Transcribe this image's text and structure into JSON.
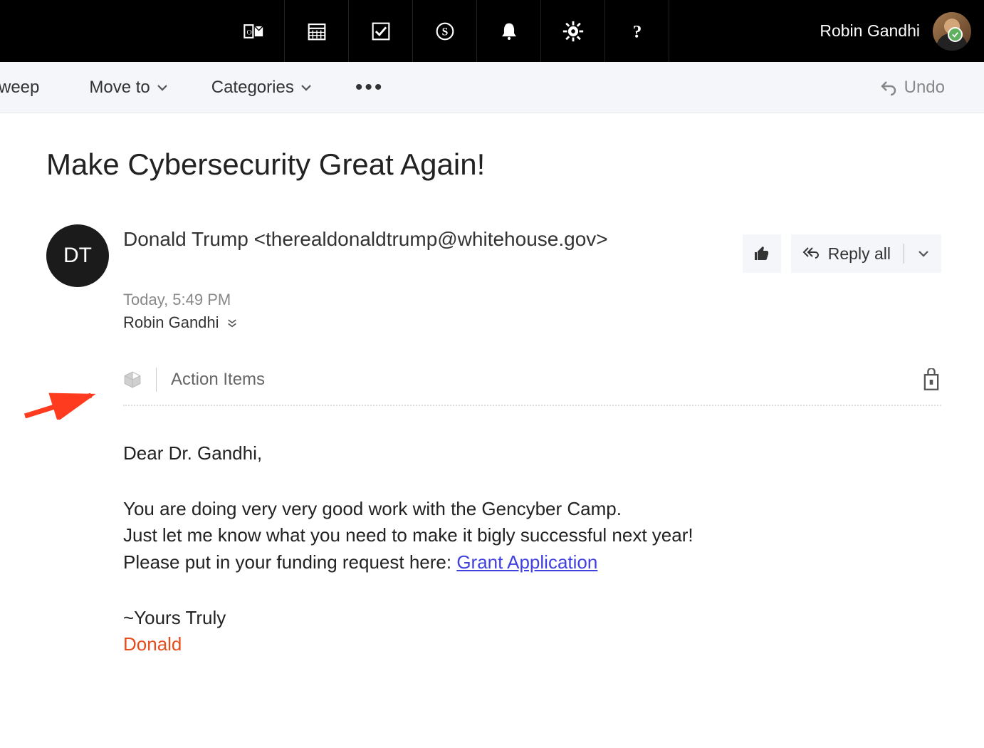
{
  "topbar": {
    "username": "Robin Gandhi"
  },
  "toolbar": {
    "sweep": "weep",
    "moveto": "Move to",
    "categories": "Categories",
    "undo": "Undo"
  },
  "message": {
    "subject": "Make Cybersecurity Great Again!",
    "sender_initials": "DT",
    "sender_display": "Donald Trump <therealdonaldtrump@whitehouse.gov>",
    "timestamp": "Today, 5:49 PM",
    "recipient": "Robin Gandhi",
    "reply_all_label": "Reply all",
    "action_items_label": "Action Items",
    "body": {
      "greeting": "Dear Dr. Gandhi,",
      "line1": "You are doing very very good work with the Gencyber Camp.",
      "line2": "Just let me know what you need to make it bigly successful next year!",
      "line3_prefix": "Please put in your funding request here: ",
      "link_text": "Grant Application",
      "closing": "~Yours Truly",
      "signature": "Donald"
    }
  }
}
